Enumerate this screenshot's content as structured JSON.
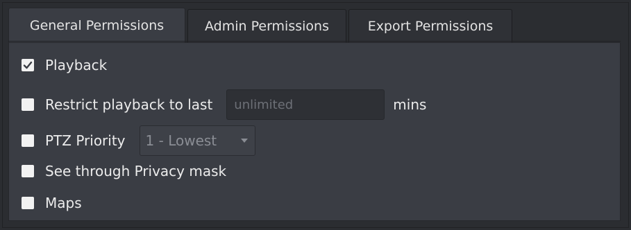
{
  "tabs": [
    {
      "label": "General Permissions",
      "active": true
    },
    {
      "label": "Admin Permissions",
      "active": false
    },
    {
      "label": "Export Permissions",
      "active": false
    }
  ],
  "permissions": {
    "playback": {
      "label": "Playback",
      "checked": true
    },
    "restrict_playback": {
      "label": "Restrict playback to last",
      "checked": false,
      "input_placeholder": "unlimited",
      "unit": "mins"
    },
    "ptz_priority": {
      "label": "PTZ Priority",
      "checked": false,
      "selected": "1 - Lowest"
    },
    "privacy_mask": {
      "label": "See through Privacy mask",
      "checked": false
    },
    "maps": {
      "label": "Maps",
      "checked": false
    }
  },
  "colors": {
    "background": "#2b2d31",
    "panel": "#3a3d44",
    "checkbox": "#f2f2f2",
    "text": "#ececec"
  }
}
